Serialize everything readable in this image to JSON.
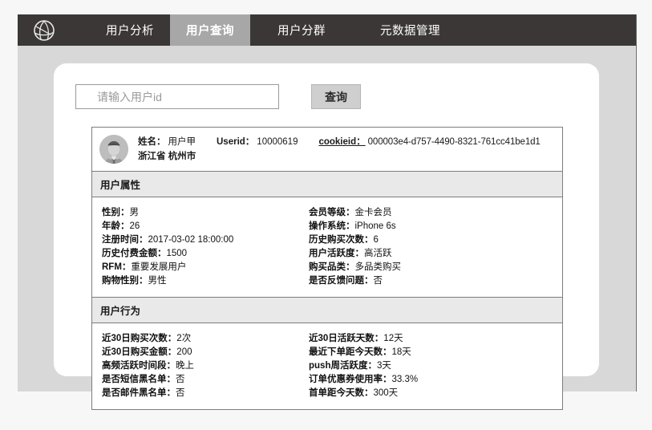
{
  "navbar": {
    "logo_icon": "globe-network-logo-icon",
    "tabs": [
      {
        "label": "用户分析",
        "active": false
      },
      {
        "label": "用户查询",
        "active": true
      },
      {
        "label": "用户分群",
        "active": false
      },
      {
        "label": "元数据管理",
        "active": false
      }
    ]
  },
  "search": {
    "placeholder": "请输入用户id",
    "value": "",
    "button_label": "查询"
  },
  "profile": {
    "avatar_icon": "user-avatar-icon",
    "name_label": "姓名：",
    "name_value": "用户甲",
    "userid_label": "Userid：",
    "userid_value": "10000619",
    "cookieid_label": "cookieid：",
    "cookieid_value": "000003e4-d757-4490-8321-761cc41be1d1",
    "location": "浙江省  杭州市"
  },
  "attributes": {
    "title": "用户属性",
    "left": [
      {
        "k": "性别：",
        "v": "男"
      },
      {
        "k": "年龄：",
        "v": "26"
      },
      {
        "k": "注册时间：",
        "v": "2017-03-02 18:00:00"
      },
      {
        "k": "历史付费金额：",
        "v": "1500"
      },
      {
        "k": "RFM：",
        "v": "重要发展用户"
      },
      {
        "k": "购物性别：",
        "v": "男性"
      }
    ],
    "right": [
      {
        "k": "会员等级：",
        "v": "金卡会员"
      },
      {
        "k": "操作系统：",
        "v": "iPhone 6s"
      },
      {
        "k": "历史购买次数：",
        "v": "6"
      },
      {
        "k": "用户活跃度：",
        "v": "高活跃"
      },
      {
        "k": "购买品类：",
        "v": "多品类购买"
      },
      {
        "k": "是否反馈问题：",
        "v": "否"
      }
    ]
  },
  "behavior": {
    "title": "用户行为",
    "left": [
      {
        "k": "近30日购买次数：",
        "v": "2次"
      },
      {
        "k": "近30日购买金额：",
        "v": "200"
      },
      {
        "k": "高频活跃时间段：",
        "v": "晚上"
      },
      {
        "k": "是否短信黑名单：",
        "v": "否"
      },
      {
        "k": "是否邮件黑名单：",
        "v": "否"
      }
    ],
    "right": [
      {
        "k": "近30日活跃天数：",
        "v": "12天"
      },
      {
        "k": "最近下单距今天数：",
        "v": "18天"
      },
      {
        "k": "push周活跃度：",
        "v": "3天"
      },
      {
        "k": "订单优惠券使用率：",
        "v": "33.3%"
      },
      {
        "k": "首单距今天数：",
        "v": "300天"
      }
    ]
  },
  "colors": {
    "navbar_bg": "#3b3736",
    "active_tab_bg": "#a7a7a7",
    "page_bg": "#f7f7f7",
    "content_bg": "#d8d8d8",
    "panel_bg": "#ffffff",
    "section_header_bg": "#e9e9e9",
    "button_bg": "#cfcfcf",
    "border": "#7d7d7d"
  }
}
